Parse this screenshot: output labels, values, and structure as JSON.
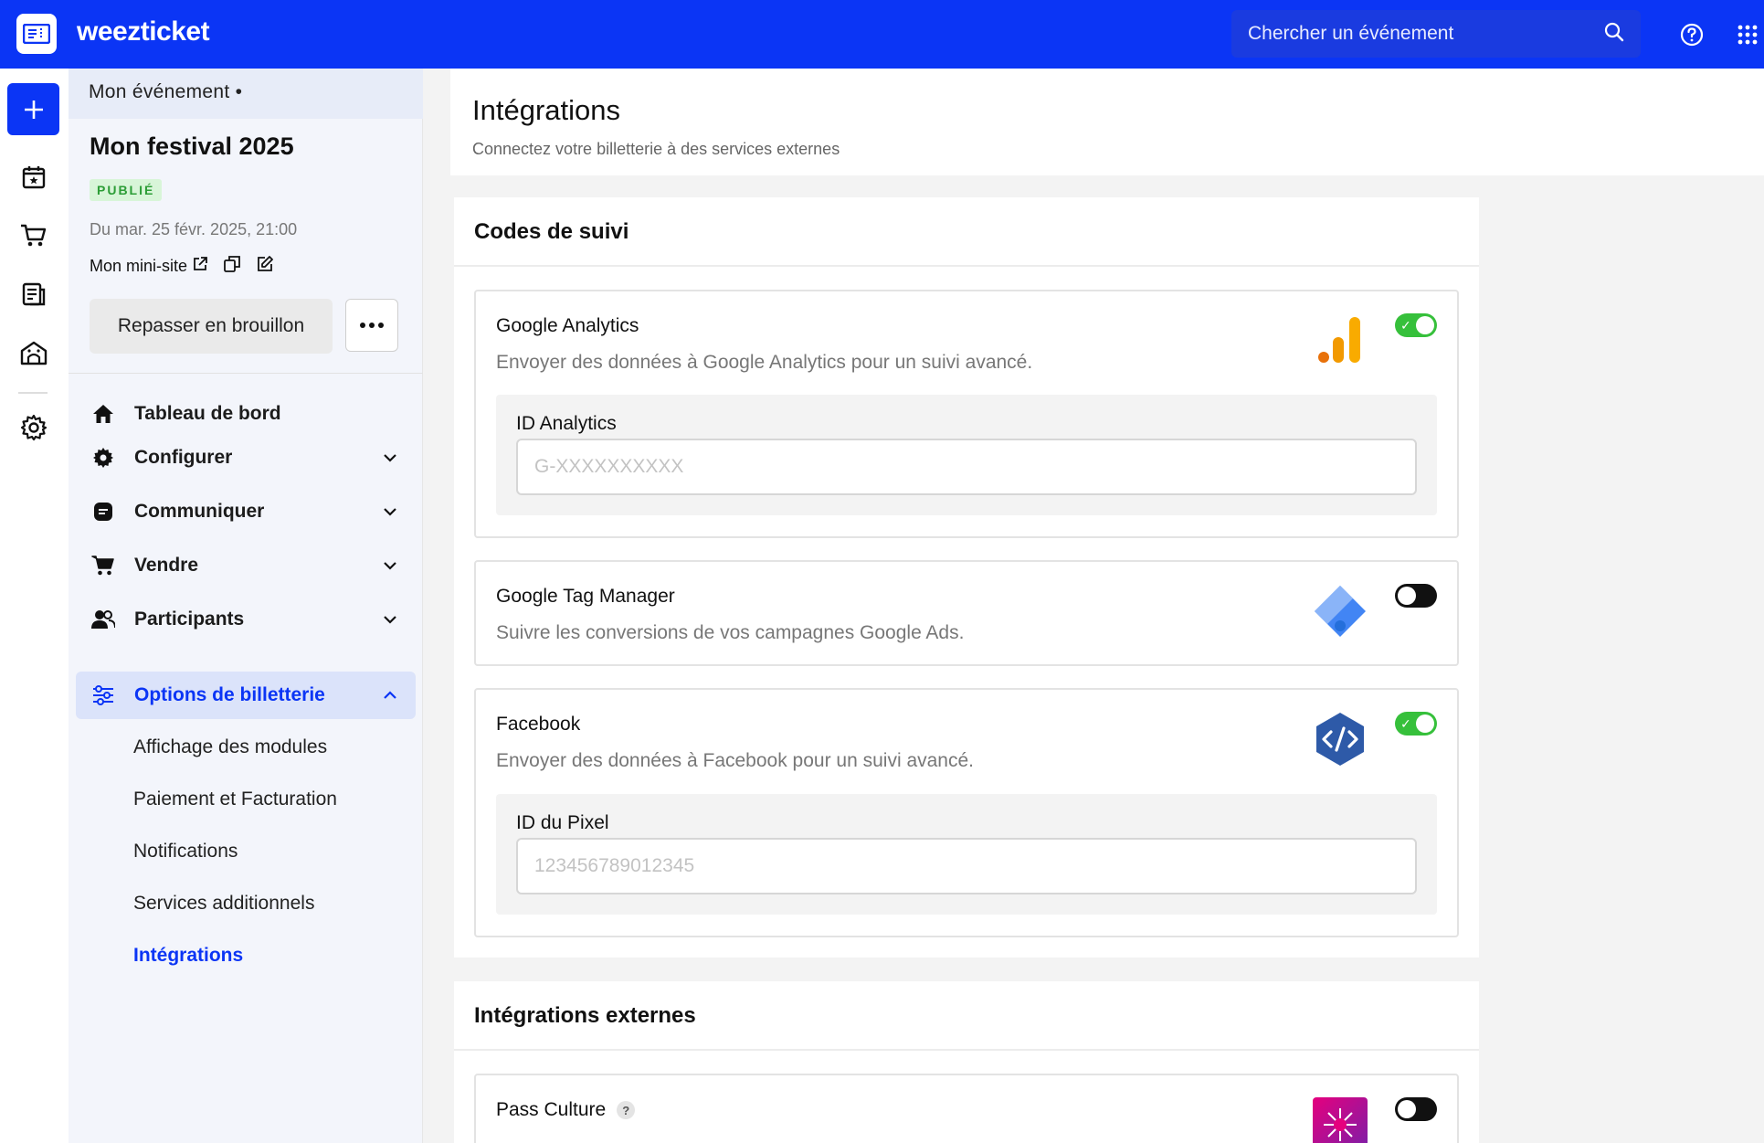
{
  "topbar": {
    "brand": "weezticket",
    "search_placeholder": "Chercher un événement",
    "accent": "#0b35f5"
  },
  "rail": {
    "icons": [
      "plus-icon",
      "calendar-star-icon",
      "cart-icon",
      "report-icon",
      "venue-icon",
      "settings-icon"
    ]
  },
  "sidebar": {
    "breadcrumb": "Mon événement •",
    "event_title": "Mon festival 2025",
    "status_badge": "PUBLIÉ",
    "date": "Du mar. 25 févr. 2025, 21:00",
    "minisite_label": "Mon mini-site",
    "draft_button": "Repasser en brouillon",
    "nav": [
      {
        "label": "Tableau de bord",
        "icon": "home-icon"
      },
      {
        "label": "Configurer",
        "icon": "gear-icon"
      },
      {
        "label": "Communiquer",
        "icon": "message-icon"
      },
      {
        "label": "Vendre",
        "icon": "cart-icon"
      },
      {
        "label": "Participants",
        "icon": "people-icon"
      },
      {
        "label": "Options de billetterie",
        "icon": "sliders-icon"
      }
    ],
    "sub_nav": [
      "Affichage des modules",
      "Paiement et Facturation",
      "Notifications",
      "Services additionnels",
      "Intégrations"
    ]
  },
  "page": {
    "title": "Intégrations",
    "subtitle": "Connectez votre billetterie à des services externes"
  },
  "tracking": {
    "heading": "Codes de suivi",
    "google_analytics": {
      "title": "Google Analytics",
      "description": "Envoyer des données à Google Analytics pour un suivi avancé.",
      "enabled": true,
      "field_label": "ID Analytics",
      "field_placeholder": "G-XXXXXXXXXX"
    },
    "google_tag_manager": {
      "title": "Google Tag Manager",
      "description": "Suivre les conversions de vos campagnes Google Ads.",
      "enabled": false
    },
    "facebook": {
      "title": "Facebook",
      "description": "Envoyer des données à Facebook pour un suivi avancé.",
      "enabled": true,
      "field_label": "ID du Pixel",
      "field_placeholder": "123456789012345"
    }
  },
  "external": {
    "heading": "Intégrations externes",
    "pass_culture": {
      "title": "Pass Culture",
      "help": "?",
      "enabled": false
    }
  },
  "colors": {
    "toggle_on": "#36c03b",
    "toggle_off": "#111111",
    "active_nav_bg": "#dbe3fa",
    "badge_green": "#2c9d36"
  }
}
